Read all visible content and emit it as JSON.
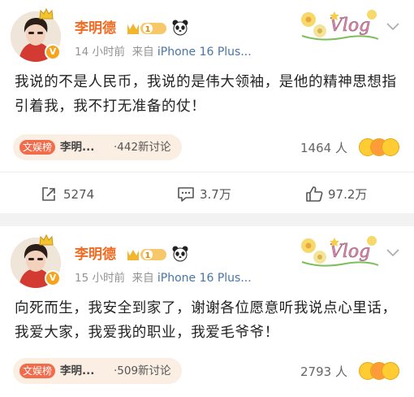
{
  "posts": [
    {
      "author": "李明德",
      "level": "1",
      "time": "14 小时前",
      "source_prefix": "来自",
      "device": "iPhone 16 Plus...",
      "content": "我说的不是人民币，我说的是伟大领袖，是他的精神思想指引着我，我不打无准备的仗！",
      "hot_tag": "文娱榜",
      "hot_name": "李明...",
      "hot_discussion": "·442新讨论",
      "reactions_count": "1464 人",
      "actions": {
        "repost": "5274",
        "comment": "3.7万",
        "like": "97.2万"
      }
    },
    {
      "author": "李明德",
      "level": "1",
      "time": "15 小时前",
      "source_prefix": "来自",
      "device": "iPhone 16 Plus...",
      "content": "向死而生，我安全到家了，谢谢各位愿意听我说点心里话，我爱大家，我爱我的职业，我爱毛爷爷！",
      "hot_tag": "文娱榜",
      "hot_name": "李明...",
      "hot_discussion": "·509新讨论",
      "reactions_count": "2793 人"
    }
  ],
  "badge_text": "V",
  "vlog_text": "Vlog",
  "colors": {
    "name": "#f26b21",
    "link": "#4775a8",
    "hot_tag": "#f26b4a",
    "hot_bg": "#fbeee3"
  },
  "icons": [
    "crown-icon",
    "panda-icon",
    "chevron-down-icon",
    "repost-icon",
    "comment-icon",
    "like-icon",
    "laugh-emoji-icon"
  ]
}
